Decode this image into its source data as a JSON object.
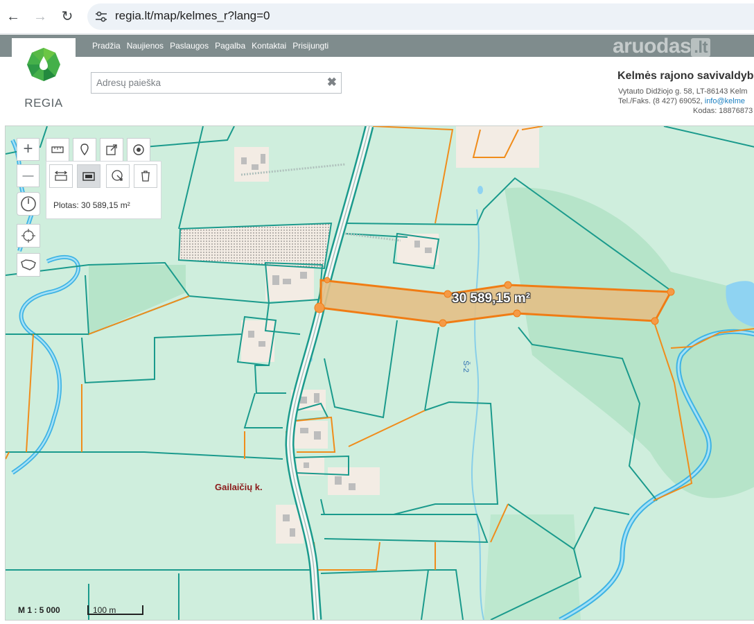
{
  "browser": {
    "url": "regia.lt/map/kelmes_r?lang=0",
    "back_glyph": "←",
    "forward_glyph": "→",
    "reload_glyph": "↻"
  },
  "site": {
    "logo_text": "REGIA",
    "menu": [
      "Pradžia",
      "Naujienos",
      "Paslaugos",
      "Pagalba",
      "Kontaktai",
      "Prisijungti"
    ],
    "watermark_main": "aruodas",
    "watermark_tld": ".lt",
    "search_placeholder": "Adresų paieška",
    "clear_glyph": "✖"
  },
  "municipality": {
    "title": "Kelmės rajono savivaldyb",
    "address": "Vytauto Didžiojo g. 58, LT-86143 Kelm",
    "phone": "Tel./Faks. (8 427) 69052,",
    "email": "info@kelme",
    "code": "Kodas: 18876873"
  },
  "map": {
    "zoom_in_glyph": "+",
    "zoom_out_glyph": "—",
    "area_label": "Plotas: 30 589,15 m²",
    "measure_label": "30 589,15 m²",
    "village": "Gailaičių k.",
    "road": "Š-2",
    "scale_text": "M 1 : 5 000",
    "scalebar_text": "100 m"
  },
  "colors": {
    "map_bg": "#cfeedd",
    "forest": "#b8e6cc",
    "parcel_line": "#1a9a8c",
    "orange_line": "#f08c1a",
    "selection_fill": "#e8c58c",
    "water": "#5bc0e8",
    "nav_bar": "#7f8c8d"
  }
}
